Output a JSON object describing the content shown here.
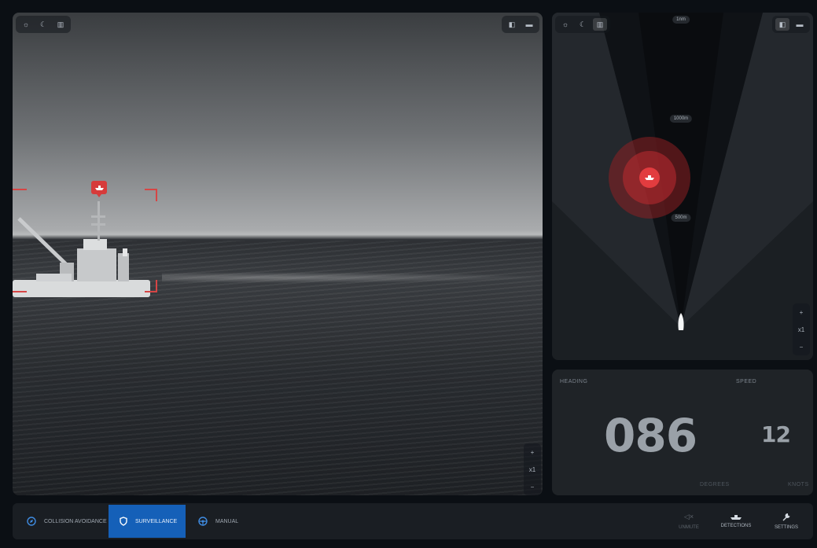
{
  "camera": {
    "toolbar_left": [
      {
        "icon": "sun-icon",
        "glyph": "☼"
      },
      {
        "icon": "moon-icon",
        "glyph": "☾"
      },
      {
        "icon": "thermal-icon",
        "glyph": "▥"
      }
    ],
    "toolbar_right": [
      {
        "icon": "layout-split-icon",
        "glyph": "◧"
      },
      {
        "icon": "layout-full-icon",
        "glyph": "▬"
      }
    ],
    "zoom": {
      "plus": "+",
      "level": "x1",
      "minus": "−"
    },
    "target_color": "#d63b3b"
  },
  "radar": {
    "toolbar_left": [
      {
        "icon": "sun-icon",
        "glyph": "☼"
      },
      {
        "icon": "moon-icon",
        "glyph": "☾"
      },
      {
        "icon": "thermal-icon",
        "glyph": "▥"
      }
    ],
    "toolbar_right": [
      {
        "icon": "layout-split-icon",
        "glyph": "◧"
      },
      {
        "icon": "layout-full-icon",
        "glyph": "▬"
      }
    ],
    "range_labels": [
      "1nm",
      "1000m",
      "500m"
    ],
    "zoom": {
      "plus": "+",
      "level": "x1",
      "minus": "−"
    }
  },
  "navigation": {
    "heading_label": "HEADING",
    "heading_value": "086",
    "heading_unit": "DEGREES",
    "speed_label": "SPEED",
    "speed_value": "12",
    "speed_unit": "KNOTS"
  },
  "bottom_bar": {
    "modes": [
      {
        "label": "COLLISION AVOIDANCE",
        "icon": "compass-icon",
        "active": false
      },
      {
        "label": "SURVEILLANCE",
        "icon": "shield-icon",
        "active": true
      },
      {
        "label": "MANUAL",
        "icon": "steering-wheel-icon",
        "active": false
      }
    ],
    "tools": [
      {
        "label": "UNMUTE",
        "icon": "speaker-muted-icon",
        "glyph": "🔇",
        "dim": true
      },
      {
        "label": "DETECTIONS",
        "icon": "boat-icon",
        "glyph": "⛴",
        "dim": false
      },
      {
        "label": "SETTINGS",
        "icon": "wrench-icon",
        "glyph": "🔧",
        "dim": false
      }
    ],
    "accent": "#1560b8"
  }
}
